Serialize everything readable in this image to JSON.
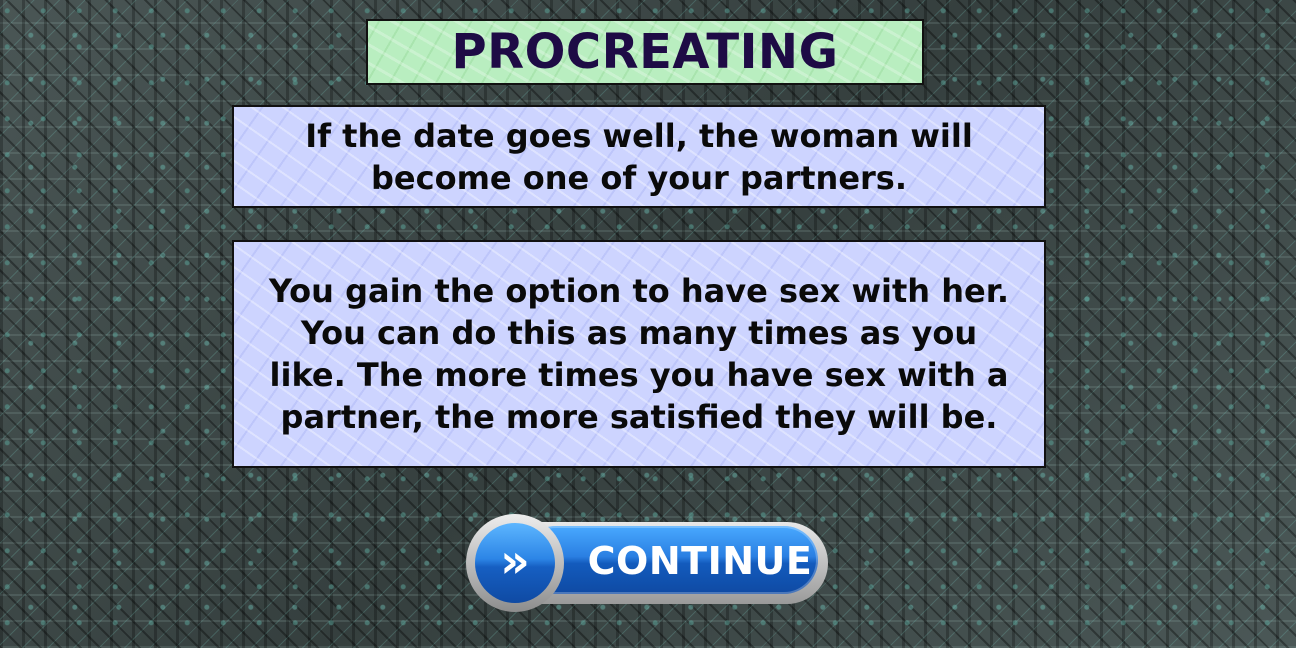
{
  "screen": {
    "title": "PROCREATING",
    "info_1": "If the date goes well, the woman will become one of your partners.",
    "info_2": "You gain the option to have sex with her. You can do this as many times as you like. The more times you have sex with a partner, the more satisfied they will be.",
    "continue_label": "CONTINUE",
    "continue_icon": "double-chevron-right-icon"
  },
  "colors": {
    "title_bg": "#b9eec0",
    "title_text": "#1e0b45",
    "panel_bg": "#cdd4ff",
    "button_blue": "#2a7fe2",
    "background": "#3c4746"
  }
}
